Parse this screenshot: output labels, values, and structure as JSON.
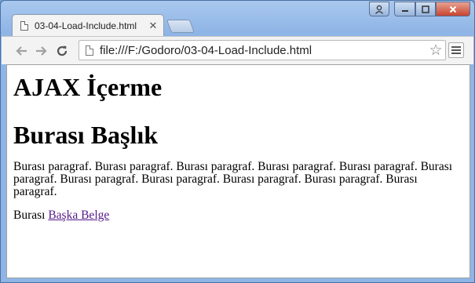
{
  "browser": {
    "tab_title": "03-04-Load-Include.html",
    "url": "file:///F:/Godoro/03-04-Load-Include.html",
    "icons": {
      "back": "back-arrow-icon",
      "forward": "forward-arrow-icon",
      "reload": "reload-icon",
      "star": "star-icon",
      "menu": "hamburger-menu-icon",
      "page": "page-icon",
      "close_tab": "close-icon"
    }
  },
  "page": {
    "heading1": "AJAX İçerme",
    "heading2": "Burası Başlık",
    "paragraph": "Burası paragraf. Burası paragraf. Burası paragraf. Burası paragraf. Burası paragraf. Burası paragraf. Burası paragraf. Burası paragraf. Burası paragraf. Burası paragraf. Burası paragraf.",
    "link_prefix": "Burası",
    "link_text": "Başka Belge"
  },
  "colors": {
    "link": "#551a8b",
    "close_button": "#c7452f"
  }
}
